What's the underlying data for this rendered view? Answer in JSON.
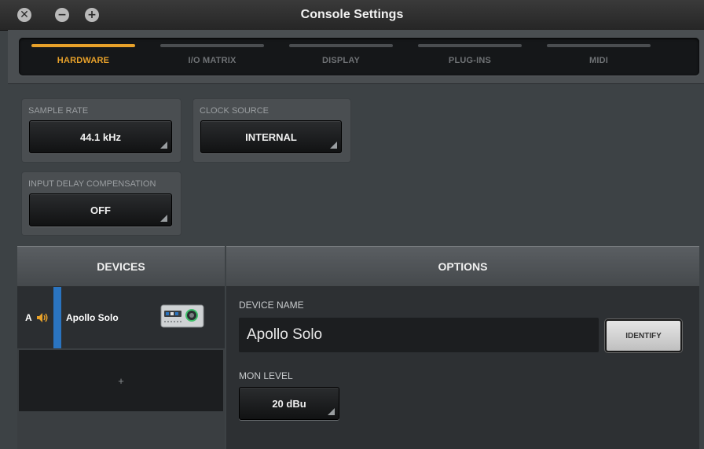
{
  "window": {
    "title": "Console Settings",
    "controls": {
      "close_glyph": "✕",
      "minimize_glyph": "−",
      "zoom_glyph": "+"
    }
  },
  "tabs": [
    {
      "label": "HARDWARE",
      "active": true
    },
    {
      "label": "I/O MATRIX",
      "active": false
    },
    {
      "label": "DISPLAY",
      "active": false
    },
    {
      "label": "PLUG-INS",
      "active": false
    },
    {
      "label": "MIDI",
      "active": false
    }
  ],
  "hardware": {
    "sample_rate": {
      "label": "SAMPLE RATE",
      "value": "44.1 kHz"
    },
    "clock_source": {
      "label": "CLOCK SOURCE",
      "value": "INTERNAL"
    },
    "input_delay": {
      "label": "INPUT DELAY COMPENSATION",
      "value": "OFF"
    }
  },
  "devices": {
    "header": "DEVICES",
    "items": [
      {
        "slot": "A",
        "name": "Apollo Solo"
      }
    ],
    "add_label": "+"
  },
  "options": {
    "header": "OPTIONS",
    "device_name_label": "DEVICE NAME",
    "device_name_value": "Apollo Solo",
    "identify_label": "IDENTIFY",
    "mon_level_label": "MON LEVEL",
    "mon_level_value": "20 dBu"
  },
  "colors": {
    "accent": "#e7a12a",
    "device_selected": "#2a74c0"
  }
}
